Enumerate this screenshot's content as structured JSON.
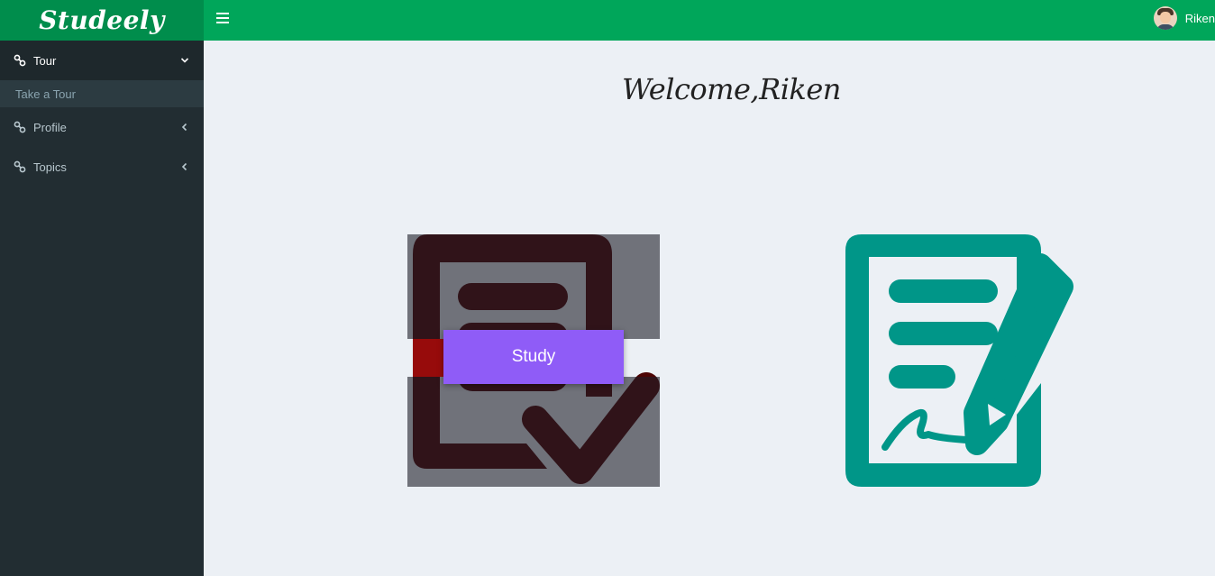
{
  "brand": {
    "name": "Studeely"
  },
  "header": {
    "user_name": "Riken"
  },
  "sidebar": {
    "items": [
      {
        "label": "Tour",
        "expanded": true
      },
      {
        "label": "Profile",
        "expanded": false
      },
      {
        "label": "Topics",
        "expanded": false
      }
    ],
    "tour_sub": [
      {
        "label": "Take a Tour"
      }
    ]
  },
  "main": {
    "welcome": "Welcome,Riken",
    "cards": [
      {
        "label": "Study",
        "icon": "checklist-icon",
        "color": "#4d0404"
      },
      {
        "icon": "document-signature-icon",
        "color": "#009688"
      }
    ]
  },
  "colors": {
    "topbar": "#00a65a",
    "logo_bg": "#008d4c",
    "sidebar": "#222d32",
    "button": "#8f5cf7",
    "background": "#ecf0f5"
  }
}
